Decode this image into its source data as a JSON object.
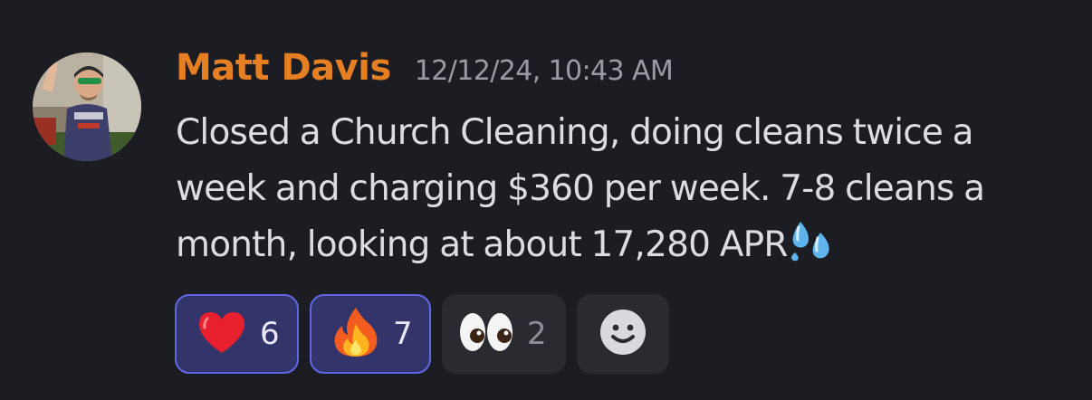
{
  "message": {
    "author": "Matt Davis",
    "timestamp": "12/12/24, 10:43 AM",
    "text": "Closed a Church Cleaning, doing cleans twice a week and charging $360 per week. 7-8 cleans a month, looking at about 17,280 APR",
    "trailing_emoji": "sweat-droplets-icon",
    "author_color": "#e67e22",
    "avatar": "user-avatar-photo"
  },
  "reactions": [
    {
      "emoji": "red-heart-icon",
      "count": "6",
      "active": true
    },
    {
      "emoji": "fire-icon",
      "count": "7",
      "active": true
    },
    {
      "emoji": "eyes-icon",
      "count": "2",
      "active": false
    }
  ],
  "add_reaction": {
    "icon": "add-reaction-smiley-icon"
  },
  "colors": {
    "background": "#1c1d22",
    "active_reaction_bg": "#33356a",
    "active_reaction_border": "#5f67e6",
    "inactive_reaction_bg": "#2a2b31",
    "timestamp": "#9a9ca4",
    "text": "#dcdde2"
  }
}
